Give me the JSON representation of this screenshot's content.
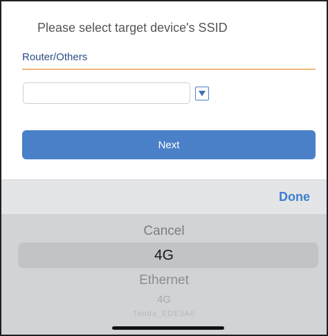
{
  "header": {
    "title": "Please select target device's SSID",
    "subtitle": "Router/Others"
  },
  "form": {
    "ssid_value": "",
    "dropdown_icon": "triangle-down-icon",
    "next_label": "Next"
  },
  "picker": {
    "done_label": "Done",
    "options": [
      "Cancel",
      "4G",
      "Ethernet",
      "4G",
      "Tenda_EDE3A0"
    ],
    "selected": "4G"
  },
  "colors": {
    "accent": "#4a80c8",
    "divider": "#f0b879",
    "done": "#3b7fcf"
  }
}
